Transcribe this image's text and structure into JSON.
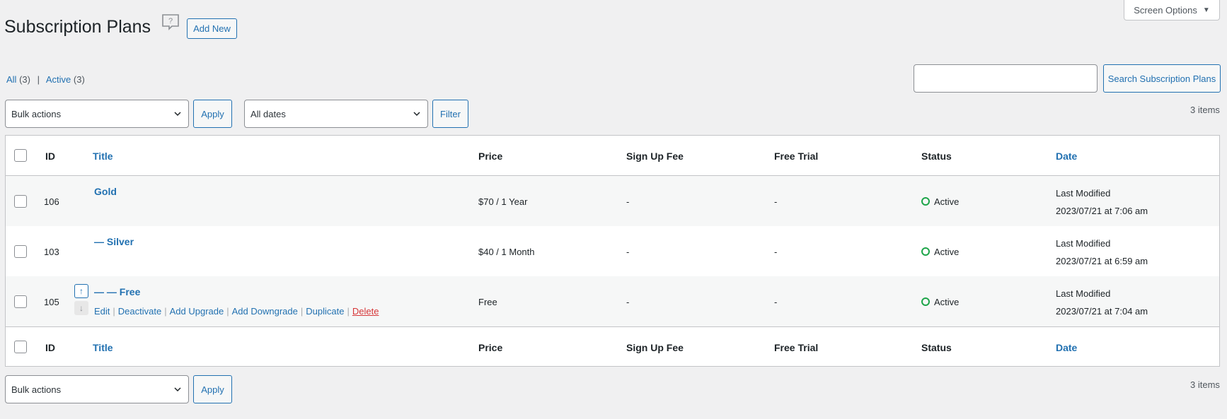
{
  "header": {
    "title": "Subscription Plans",
    "add_new_label": "Add New",
    "screen_options_label": "Screen Options"
  },
  "filters": {
    "all_label": "All",
    "all_count": "(3)",
    "active_label": "Active",
    "active_count": "(3)"
  },
  "search": {
    "placeholder": "",
    "button_label": "Search Subscription Plans"
  },
  "tablenav": {
    "bulk_actions": "Bulk actions",
    "apply_label": "Apply",
    "dates_selected": "All dates",
    "filter_label": "Filter",
    "items_count": "3 items"
  },
  "columns": {
    "id": "ID",
    "title": "Title",
    "price": "Price",
    "sign_up_fee": "Sign Up Fee",
    "free_trial": "Free Trial",
    "status": "Status",
    "date": "Date"
  },
  "rows": [
    {
      "id": "106",
      "title": "Gold",
      "price": "$70 / 1 Year",
      "sign_up_fee": "-",
      "free_trial": "-",
      "status": "Active",
      "date_label": "Last Modified",
      "date_value": "2023/07/21 at 7:06 am"
    },
    {
      "id": "103",
      "title": "— Silver",
      "price": "$40 / 1 Month",
      "sign_up_fee": "-",
      "free_trial": "-",
      "status": "Active",
      "date_label": "Last Modified",
      "date_value": "2023/07/21 at 6:59 am"
    },
    {
      "id": "105",
      "title": "— — Free",
      "price": "Free",
      "sign_up_fee": "-",
      "free_trial": "-",
      "status": "Active",
      "date_label": "Last Modified",
      "date_value": "2023/07/21 at 7:04 am"
    }
  ],
  "row_actions": {
    "edit": "Edit",
    "deactivate": "Deactivate",
    "add_upgrade": "Add Upgrade",
    "add_downgrade": "Add Downgrade",
    "duplicate": "Duplicate",
    "delete": "Delete",
    "separator": "|"
  },
  "icons": {
    "help": "help-bubble-icon",
    "up": "arrow-up-icon",
    "down": "arrow-down-icon",
    "chevron": "chevron-down-icon",
    "status": "status-circle-icon"
  },
  "colors": {
    "accent": "#2271b1",
    "delete": "#d63638",
    "active": "#1ea54a"
  }
}
